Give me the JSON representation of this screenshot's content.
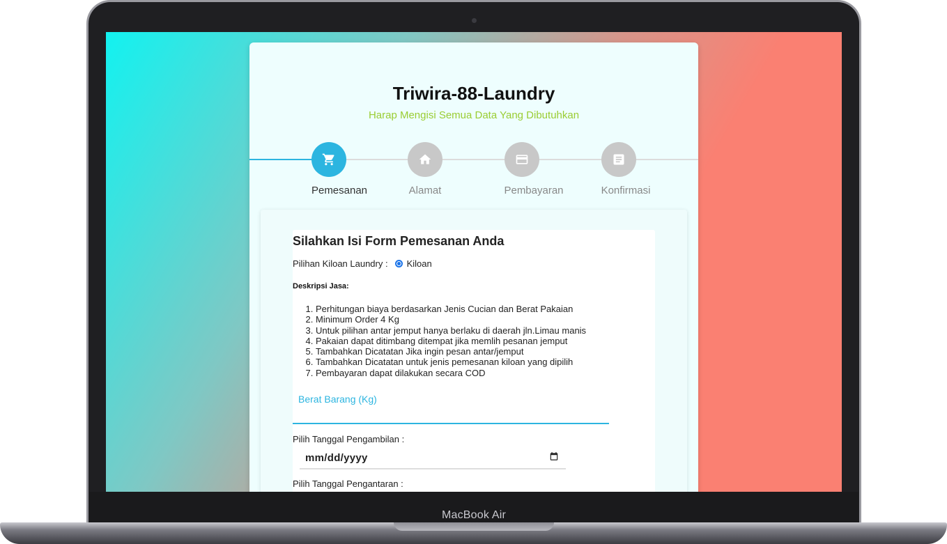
{
  "device": {
    "model_label": "MacBook Air"
  },
  "app": {
    "title": "Triwira-88-Laundry",
    "subtitle": "Harap Mengisi Semua Data Yang Dibutuhkan",
    "accent_color": "#2cb5e0",
    "subtitle_color": "#9acd32"
  },
  "stepper": {
    "steps": [
      {
        "label": "Pemesanan",
        "icon": "cart-icon",
        "active": true
      },
      {
        "label": "Alamat",
        "icon": "home-icon",
        "active": false
      },
      {
        "label": "Pembayaran",
        "icon": "credit-card-icon",
        "active": false
      },
      {
        "label": "Konfirmasi",
        "icon": "document-icon",
        "active": false
      }
    ]
  },
  "form": {
    "title": "Silahkan Isi Form Pemesanan Anda",
    "kiloan_label": "Pilihan Kiloan Laundry :",
    "kiloan_option": "Kiloan",
    "description_heading": "Deskripsi Jasa:",
    "description_items": [
      "Perhitungan biaya berdasarkan Jenis Cucian dan Berat Pakaian",
      "Minimum Order 4 Kg",
      "Untuk pilihan antar jemput hanya berlaku di daerah jln.Limau manis",
      "Pakaian dapat ditimbang ditempat jika memlih pesanan jemput",
      "Tambahkan Dicatatan Jika ingin pesan antar/jemput",
      "Tambahkan Dicatatan untuk jenis pemesanan kiloan yang dipilih",
      "Pembayaran dapat dilakukan secara COD"
    ],
    "weight_label": "Berat Barang (Kg)",
    "pickup_date_label": "Pilih Tanggal Pengambilan :",
    "pickup_date_placeholder": "mm/dd/yyyy",
    "delivery_date_label": "Pilih Tanggal Pengantaran :"
  }
}
